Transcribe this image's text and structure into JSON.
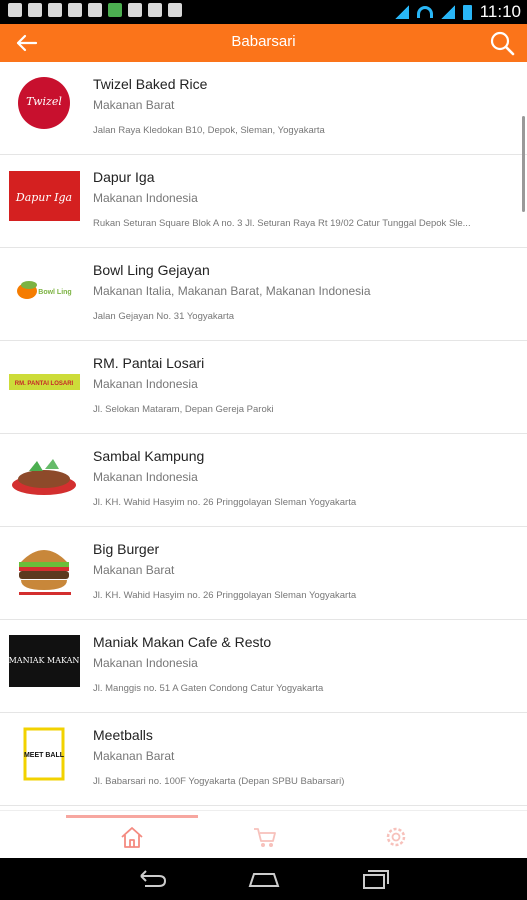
{
  "status_bar": {
    "time": "11:10"
  },
  "header": {
    "title": "Babarsari"
  },
  "restaurants": [
    {
      "name": "Twizel Baked Rice",
      "category": "Makanan Barat",
      "address": "Jalan Raya Kledokan B10, Depok, Sleman, Yogyakarta",
      "logo_text": "Twizel"
    },
    {
      "name": "Dapur Iga",
      "category": "Makanan Indonesia",
      "address": "Rukan Seturan Square Blok A no. 3 Jl. Seturan Raya Rt 19/02 Catur Tunggal Depok Sle...",
      "logo_text": "Dapur Iga"
    },
    {
      "name": "Bowl Ling Gejayan",
      "category": "Makanan Italia, Makanan Barat, Makanan Indonesia",
      "address": "Jalan Gejayan No. 31 Yogyakarta",
      "logo_text": "Bowl Ling"
    },
    {
      "name": "RM. Pantai Losari",
      "category": "Makanan Indonesia",
      "address": "Jl. Selokan Mataram, Depan Gereja Paroki",
      "logo_text": "RM. PANTAI LOSARI"
    },
    {
      "name": "Sambal Kampung",
      "category": "Makanan Indonesia",
      "address": "Jl. KH. Wahid Hasyim no. 26 Pringgolayan Sleman Yogyakarta",
      "logo_text": ""
    },
    {
      "name": "Big Burger",
      "category": "Makanan Barat",
      "address": "Jl. KH. Wahid Hasyim no. 26 Pringgolayan Sleman Yogyakarta",
      "logo_text": ""
    },
    {
      "name": "Maniak Makan Cafe & Resto",
      "category": "Makanan Indonesia",
      "address": "Jl. Manggis no. 51 A Gaten Condong Catur Yogyakarta",
      "logo_text": "MANIAK MAKAN"
    },
    {
      "name": "Meetballs",
      "category": "Makanan Barat",
      "address": "Jl. Babarsari no. 100F Yogyakarta (Depan SPBU Babarsari)",
      "logo_text": "MEET BALL"
    }
  ],
  "colors": {
    "accent": "#fb741a",
    "nav_active": "#f7a7a0"
  },
  "icons": {
    "back": "arrow-left-icon",
    "search": "search-icon",
    "home": "home-icon",
    "cart": "cart-icon",
    "settings": "gear-icon"
  }
}
